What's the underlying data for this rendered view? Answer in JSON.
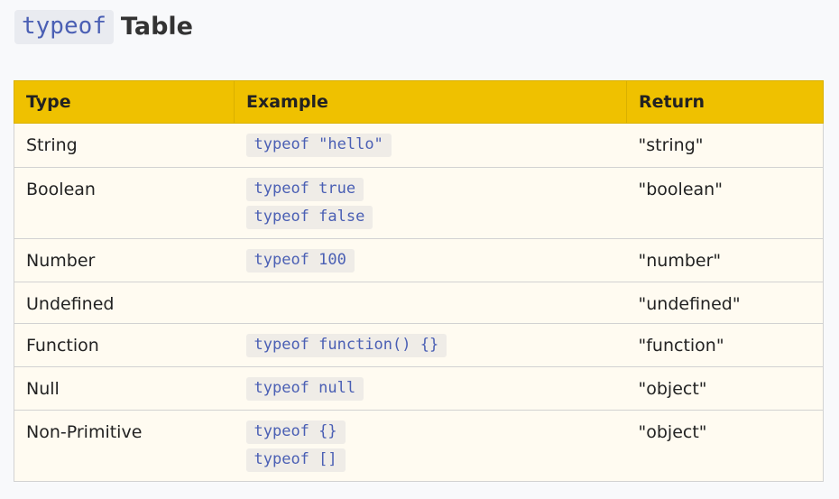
{
  "heading": {
    "code": "typeof",
    "text": "Table"
  },
  "table": {
    "headers": [
      "Type",
      "Example",
      "Return"
    ],
    "rows": [
      {
        "type": "String",
        "examples": [
          "typeof \"hello\""
        ],
        "return": "\"string\""
      },
      {
        "type": "Boolean",
        "examples": [
          "typeof true",
          "typeof false"
        ],
        "return": "\"boolean\""
      },
      {
        "type": "Number",
        "examples": [
          "typeof 100"
        ],
        "return": "\"number\""
      },
      {
        "type": "Undefined",
        "examples": [],
        "return": "\"undefined\""
      },
      {
        "type": "Function",
        "examples": [
          "typeof function() {}"
        ],
        "return": "\"function\""
      },
      {
        "type": "Null",
        "examples": [
          "typeof null"
        ],
        "return": "\"object\""
      },
      {
        "type": "Non-Primitive",
        "examples": [
          "typeof {}",
          "typeof []"
        ],
        "return": "\"object\""
      }
    ]
  },
  "colors": {
    "header_bg": "#efc100",
    "code_text": "#4a5fb4",
    "code_bg": "#efece7",
    "row_bg": "#fffbf1"
  }
}
